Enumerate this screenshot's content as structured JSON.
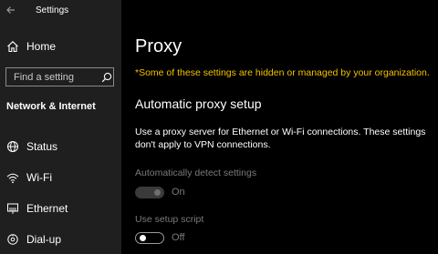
{
  "window": {
    "title": "Settings"
  },
  "sidebar": {
    "home_label": "Home",
    "search": {
      "placeholder": "Find a setting"
    },
    "section_title": "Network & Internet",
    "items": [
      {
        "label": "Status",
        "icon": "globe-icon"
      },
      {
        "label": "Wi-Fi",
        "icon": "wifi-icon"
      },
      {
        "label": "Ethernet",
        "icon": "ethernet-icon"
      },
      {
        "label": "Dial-up",
        "icon": "dialup-icon"
      }
    ]
  },
  "main": {
    "title": "Proxy",
    "org_notice": "*Some of these settings are hidden or managed by your organization.",
    "automatic": {
      "heading": "Automatic proxy setup",
      "description": "Use a proxy server for Ethernet or Wi-Fi connections. These settings don't apply to VPN connections.",
      "detect": {
        "label": "Automatically detect settings",
        "state": "On"
      },
      "script": {
        "label": "Use setup script",
        "state": "Off"
      }
    }
  },
  "colors": {
    "sidebar_bg": "#1f1f1f",
    "main_bg": "#000000",
    "warning": "#f3c300",
    "disabled_text": "#7a7a7a"
  }
}
